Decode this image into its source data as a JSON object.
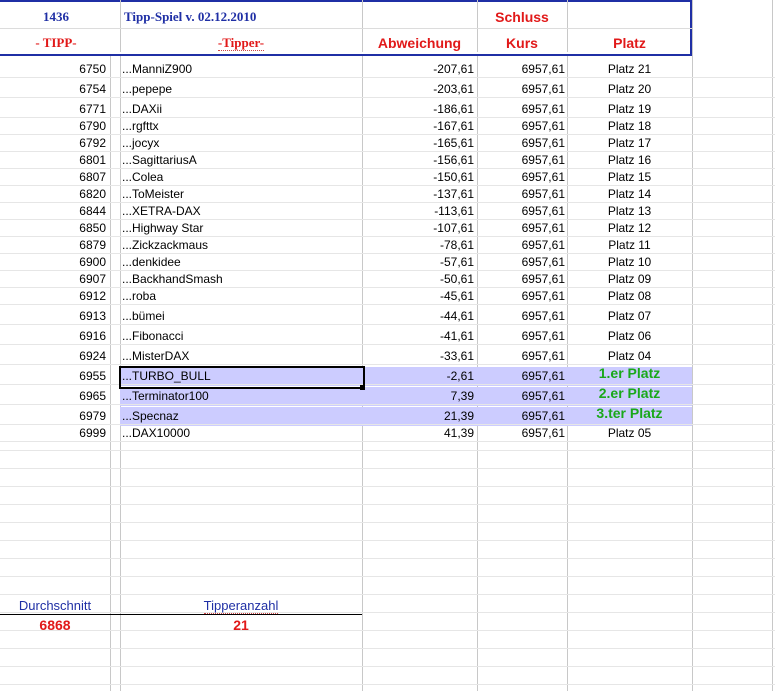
{
  "header": {
    "id_number": "1436",
    "title": "Tipp-Spiel v. 02.12.2010",
    "schluss": "Schluss",
    "col_tipp": "- TIPP-",
    "col_tipper": "-Tipper-",
    "col_abweichung": "Abweichung",
    "col_kurs": "Kurs",
    "col_platz": "Platz"
  },
  "rows": [
    {
      "tipp": "6750",
      "name": "...ManniZ900",
      "abw": "-207,61",
      "kurs": "6957,61",
      "platz": "Platz 21"
    },
    {
      "tipp": "6754",
      "name": "...pepepe",
      "abw": "-203,61",
      "kurs": "6957,61",
      "platz": "Platz 20"
    },
    {
      "tipp": "6771",
      "name": "...DAXii",
      "abw": "-186,61",
      "kurs": "6957,61",
      "platz": "Platz 19"
    },
    {
      "tipp": "6790",
      "name": "...rgfttx",
      "abw": "-167,61",
      "kurs": "6957,61",
      "platz": "Platz 18"
    },
    {
      "tipp": "6792",
      "name": "...jocyx",
      "abw": "-165,61",
      "kurs": "6957,61",
      "platz": "Platz 17"
    },
    {
      "tipp": "6801",
      "name": "...SagittariusA",
      "abw": "-156,61",
      "kurs": "6957,61",
      "platz": "Platz 16"
    },
    {
      "tipp": "6807",
      "name": "...Colea",
      "abw": "-150,61",
      "kurs": "6957,61",
      "platz": "Platz 15"
    },
    {
      "tipp": "6820",
      "name": "...ToMeister",
      "abw": "-137,61",
      "kurs": "6957,61",
      "platz": "Platz 14"
    },
    {
      "tipp": "6844",
      "name": "...XETRA-DAX",
      "abw": "-113,61",
      "kurs": "6957,61",
      "platz": "Platz 13"
    },
    {
      "tipp": "6850",
      "name": "...Highway Star",
      "abw": "-107,61",
      "kurs": "6957,61",
      "platz": "Platz 12"
    },
    {
      "tipp": "6879",
      "name": "...Zickzackmaus",
      "abw": "-78,61",
      "kurs": "6957,61",
      "platz": "Platz 11"
    },
    {
      "tipp": "6900",
      "name": "...denkidee",
      "abw": "-57,61",
      "kurs": "6957,61",
      "platz": "Platz 10"
    },
    {
      "tipp": "6907",
      "name": "...BackhandSmash",
      "abw": "-50,61",
      "kurs": "6957,61",
      "platz": "Platz 09"
    },
    {
      "tipp": "6912",
      "name": "...roba",
      "abw": "-45,61",
      "kurs": "6957,61",
      "platz": "Platz 08"
    },
    {
      "tipp": "6913",
      "name": "...bümei",
      "abw": "-44,61",
      "kurs": "6957,61",
      "platz": "Platz 07"
    },
    {
      "tipp": "6916",
      "name": "...Fibonacci",
      "abw": "-41,61",
      "kurs": "6957,61",
      "platz": "Platz 06"
    },
    {
      "tipp": "6924",
      "name": "...MisterDAX",
      "abw": "-33,61",
      "kurs": "6957,61",
      "platz": "Platz 04"
    },
    {
      "tipp": "6955",
      "name": "...TURBO_BULL",
      "abw": "-2,61",
      "kurs": "6957,61",
      "platz": "1.er Platz"
    },
    {
      "tipp": "6965",
      "name": "...Terminator100",
      "abw": "7,39",
      "kurs": "6957,61",
      "platz": "2.er Platz"
    },
    {
      "tipp": "6979",
      "name": "...Specnaz",
      "abw": "21,39",
      "kurs": "6957,61",
      "platz": "3.ter Platz"
    },
    {
      "tipp": "6999",
      "name": "...DAX10000",
      "abw": "41,39",
      "kurs": "6957,61",
      "platz": "Platz 05"
    }
  ],
  "footer": {
    "durchschnitt_label": "Durchschnitt",
    "durchschnitt_value": "6868",
    "tipperanzahl_label": "Tipperanzahl",
    "tipperanzahl_value": "21"
  },
  "colors": {
    "header_border": "#1f2fa5",
    "header_red": "#e11919",
    "winner_highlight": "#ccccff",
    "winner_green": "#1aa81a"
  }
}
